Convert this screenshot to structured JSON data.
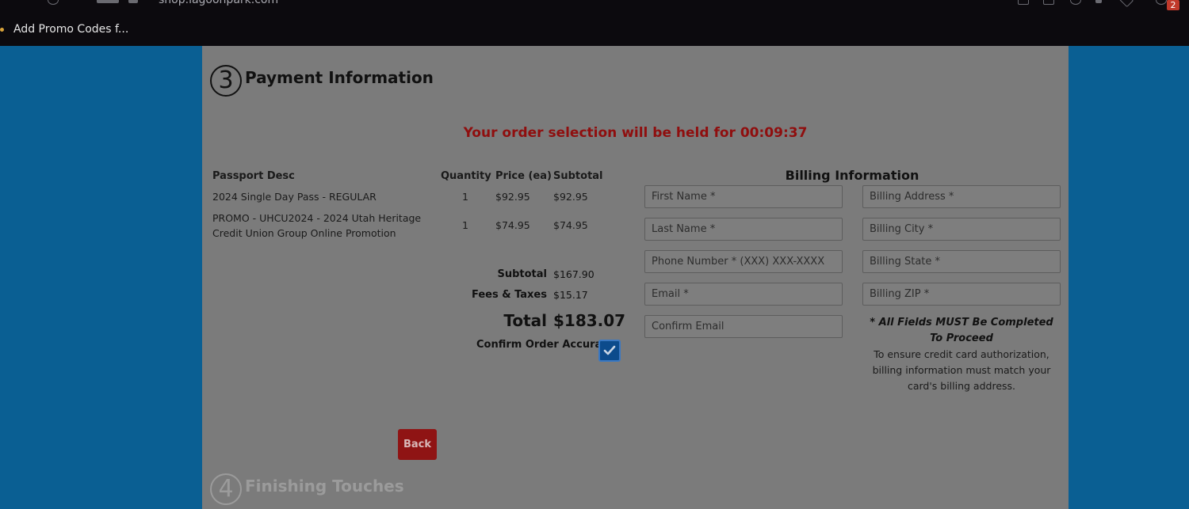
{
  "browser": {
    "url": "shop.lagoonpark.com",
    "bookmark_label": "Add Promo Codes f...",
    "notification_count": "2"
  },
  "steps": {
    "payment": {
      "number": "3",
      "title": "Payment Information"
    },
    "finishing": {
      "number": "4",
      "title": "Finishing Touches"
    }
  },
  "hold_message": "Your order selection will be held for 00:09:37",
  "order_table": {
    "headers": {
      "desc": "Passport Desc",
      "qty": "Quantity",
      "price": "Price (ea)",
      "subtotal": "Subtotal"
    },
    "rows": [
      {
        "desc": "2024 Single Day Pass - REGULAR",
        "qty": "1",
        "price": "$92.95",
        "subtotal": "$92.95"
      },
      {
        "desc": "PROMO - UHCU2024 - 2024 Utah Heritage Credit Union Group Online Promotion",
        "qty": "1",
        "price": "$74.95",
        "subtotal": "$74.95"
      }
    ]
  },
  "summary": {
    "subtotal_label": "Subtotal",
    "subtotal_value": "$167.90",
    "fees_label": "Fees & Taxes",
    "fees_value": "$15.17",
    "total_label": "Total",
    "total_value": "$183.07",
    "confirm_label": "Confirm Order Accuracy",
    "confirm_checked": true
  },
  "billing": {
    "title": "Billing Information",
    "first_name": {
      "placeholder": "First Name *",
      "value": ""
    },
    "last_name": {
      "placeholder": "Last Name *",
      "value": ""
    },
    "phone": {
      "placeholder": "Phone Number * (XXX) XXX-XXXX",
      "value": ""
    },
    "email": {
      "placeholder": "Email *",
      "value": ""
    },
    "confirm_email": {
      "placeholder": "Confirm Email",
      "value": ""
    },
    "address": {
      "placeholder": "Billing Address *",
      "value": ""
    },
    "city": {
      "placeholder": "Billing City *",
      "value": ""
    },
    "state": {
      "placeholder": "Billing State *",
      "value": ""
    },
    "zip": {
      "placeholder": "Billing ZIP *",
      "value": ""
    },
    "required_notice": "* All Fields MUST Be Completed To Proceed",
    "auth_notice": "To ensure credit card authorization, billing information must match your card's billing address."
  },
  "buttons": {
    "back": "Back"
  },
  "colors": {
    "page_bg": "#0a5f93",
    "panel_dim": "#7b7b7b",
    "hold_red": "#8f0e0e",
    "back_red": "#8f1414",
    "checkbox_blue": "#0c4b8c"
  }
}
